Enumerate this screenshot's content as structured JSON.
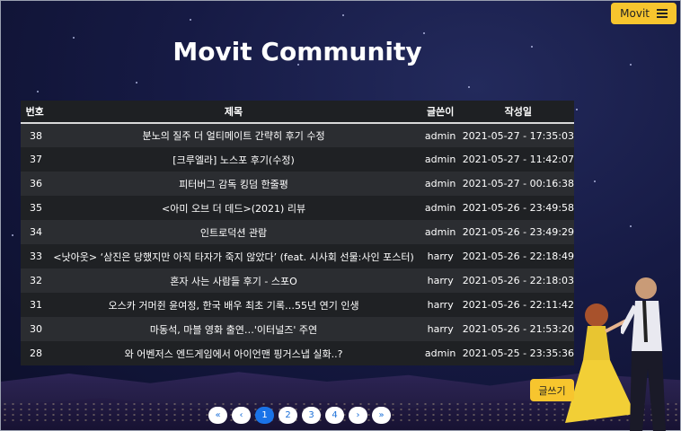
{
  "header": {
    "menu_label": "Movit",
    "title": "Movit Community"
  },
  "table": {
    "columns": [
      "번호",
      "제목",
      "글쓴이",
      "작성일"
    ],
    "rows": [
      {
        "num": "38",
        "title": "분노의 질주 더 얼티메이트 간략히 후기 수정",
        "author": "admin",
        "date": "2021-05-27 - 17:35:03"
      },
      {
        "num": "37",
        "title": "[크루엘라] 노스포 후기(수정)",
        "author": "admin",
        "date": "2021-05-27 - 11:42:07"
      },
      {
        "num": "36",
        "title": "피터버그 감독 킹덤 한줄평",
        "author": "admin",
        "date": "2021-05-27 - 00:16:38"
      },
      {
        "num": "35",
        "title": "<아미 오브 더 데드>(2021) 리뷰",
        "author": "admin",
        "date": "2021-05-26 - 23:49:58"
      },
      {
        "num": "34",
        "title": "인트로덕션 관람",
        "author": "admin",
        "date": "2021-05-26 - 23:49:29"
      },
      {
        "num": "33",
        "title": "<낫아웃> ‘삼진은 당했지만 아직 타자가 죽지 않았다’ (feat. 시사회 선물:사인 포스터)",
        "author": "harry",
        "date": "2021-05-26 - 22:18:49"
      },
      {
        "num": "32",
        "title": "혼자 사는 사람들 후기 - 스포O",
        "author": "harry",
        "date": "2021-05-26 - 22:18:03"
      },
      {
        "num": "31",
        "title": "오스카 거머쥔 윤여정, 한국 배우 최초 기록…55년 연기 인생",
        "author": "harry",
        "date": "2021-05-26 - 22:11:42"
      },
      {
        "num": "30",
        "title": "마동석, 마블 영화 출연…'이터널즈' 주연",
        "author": "harry",
        "date": "2021-05-26 - 21:53:20"
      },
      {
        "num": "28",
        "title": "와 어벤저스 엔드게임에서 아이언맨 핑거스냅 실화..?",
        "author": "admin",
        "date": "2021-05-25 - 23:35:36"
      }
    ]
  },
  "write_button": "글쓰기",
  "pagination": {
    "first": "«",
    "prev": "‹",
    "pages": [
      "1",
      "2",
      "3",
      "4"
    ],
    "next": "›",
    "last": "»",
    "active_page": "1"
  },
  "colors": {
    "accent": "#f7c52e",
    "page_active": "#1a73e8"
  }
}
